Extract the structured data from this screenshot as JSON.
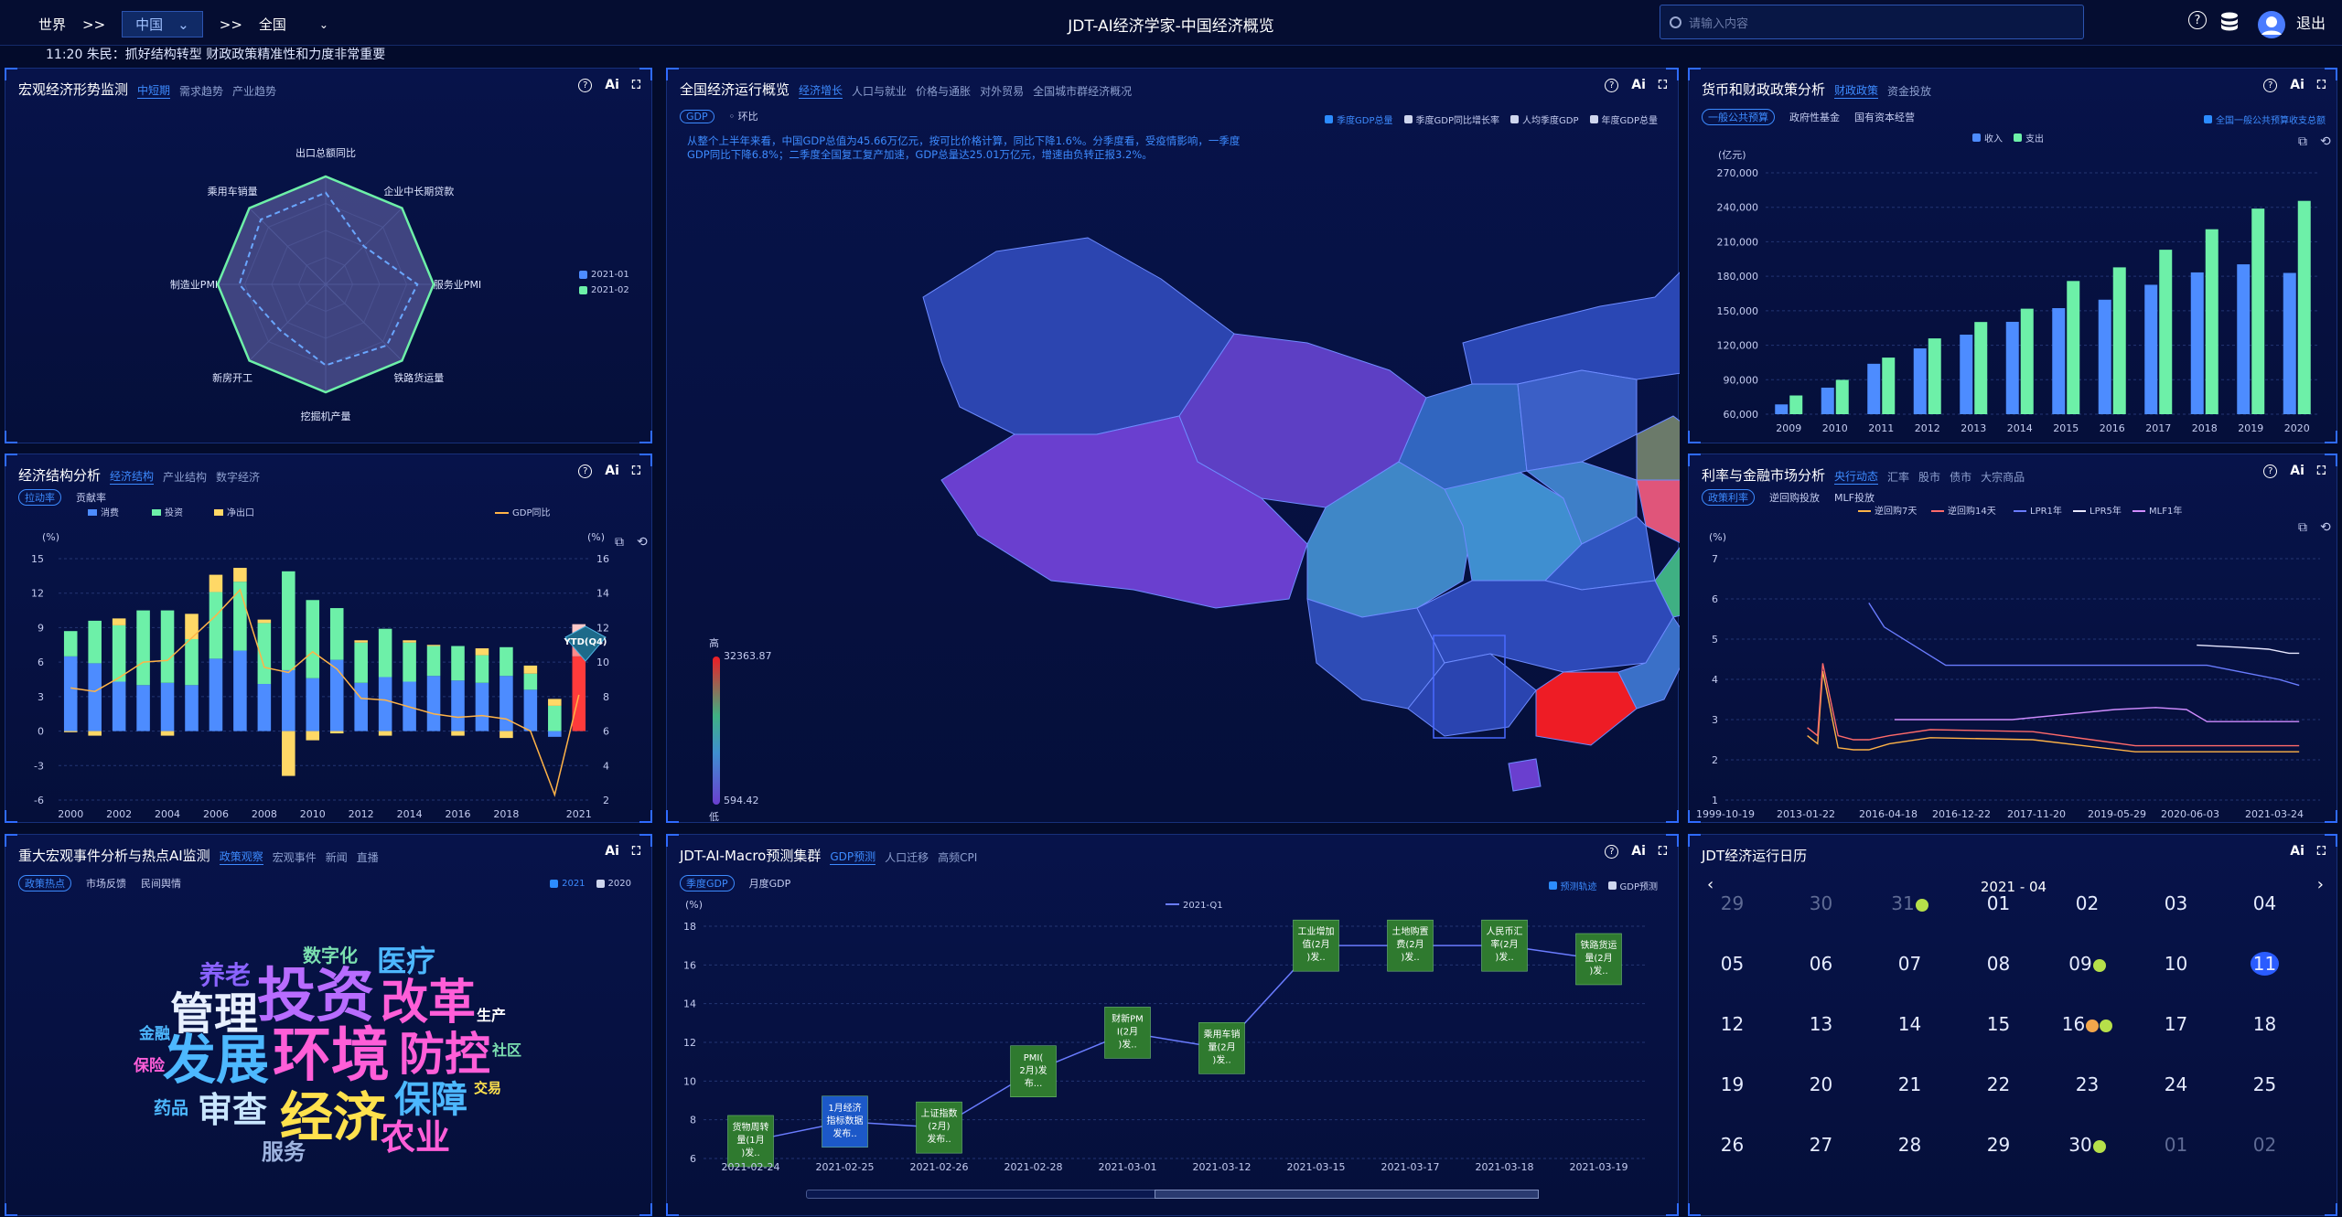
{
  "topbar": {
    "crumb_world": "世界",
    "sep1": ">>",
    "selected_region": "中国",
    "sep2": ">>",
    "crumb_all": "全国",
    "title": "JDT-AI经济学家-中国经济概览",
    "search_placeholder": "请输入内容",
    "logout": "退出"
  },
  "ticker": "11:20  朱民：抓好结构转型 财政政策精准性和力度非常重要",
  "macro": {
    "title": "宏观经济形势监测",
    "tabs": [
      "中短期",
      "需求趋势",
      "产业趋势"
    ],
    "axes": [
      "出口总额同比",
      "企业中长期贷款",
      "服务业PMI",
      "铁路货运量",
      "挖掘机产量",
      "新房开工",
      "制造业PMI",
      "乘用车销量"
    ],
    "legend": [
      "2021-01",
      "2021-02"
    ]
  },
  "structure": {
    "title": "经济结构分析",
    "tabs": [
      "经济结构",
      "产业结构",
      "数字经济"
    ],
    "subtabs": [
      "拉动率",
      "贡献率"
    ],
    "legend": [
      "消费",
      "投资",
      "净出口"
    ],
    "legend_line": "GDP同比",
    "unit_left": "(%)",
    "unit_right": "(%)",
    "yticks_left": [
      "15",
      "12",
      "9",
      "6",
      "3",
      "0",
      "-3",
      "-6"
    ],
    "yticks_right": [
      "16",
      "14",
      "12",
      "10",
      "8",
      "6",
      "4",
      "2"
    ],
    "xticks": [
      "2000",
      "2002",
      "2004",
      "2006",
      "2008",
      "2010",
      "2012",
      "2014",
      "2016",
      "2018",
      "2021"
    ],
    "badge": "YTD(Q4)"
  },
  "overview": {
    "title": "全国经济运行概览",
    "tabs": [
      "经济增长",
      "人口与就业",
      "价格与通胀",
      "对外贸易",
      "全国城市群经济概况"
    ],
    "subtabs": [
      "GDP",
      "环比"
    ],
    "legend": [
      "季度GDP总量",
      "季度GDP同比增长率",
      "人均季度GDP",
      "年度GDP总量"
    ],
    "text": "从整个上半年来看，中国GDP总值为45.66万亿元，按可比价格计算，同比下降1.6%。分季度看，受疫情影响，一季度GDP同比下降6.8%；二季度全国复工复产加速，GDP总量达25.01万亿元，增速由负转正报3.2%。",
    "scale_high": "高",
    "scale_low": "低",
    "scale_max": "32363.87",
    "scale_min": "594.42"
  },
  "fiscal": {
    "title": "货币和财政政策分析",
    "tabs": [
      "财政政策",
      "资金投放"
    ],
    "subtabs": [
      "一般公共预算",
      "政府性基金",
      "国有资本经营"
    ],
    "legend_right": "全国一般公共预算收支总额",
    "legend": [
      "收入",
      "支出"
    ],
    "unit": "(亿元)",
    "yticks": [
      "270,000",
      "240,000",
      "210,000",
      "180,000",
      "150,000",
      "120,000",
      "90,000",
      "60,000"
    ],
    "years": [
      "2009",
      "2010",
      "2011",
      "2012",
      "2013",
      "2014",
      "2015",
      "2016",
      "2017",
      "2018",
      "2019",
      "2020"
    ]
  },
  "rates": {
    "title": "利率与金融市场分析",
    "tabs": [
      "央行动态",
      "汇率",
      "股市",
      "债市",
      "大宗商品"
    ],
    "subtabs": [
      "政策利率",
      "逆回购投放",
      "MLF投放"
    ],
    "legend": [
      "逆回购7天",
      "逆回购14天",
      "LPR1年",
      "LPR5年",
      "MLF1年"
    ],
    "unit": "(%)",
    "yticks": [
      "7",
      "6",
      "5",
      "4",
      "3",
      "2",
      "1"
    ],
    "xticks": [
      "1999-10-19",
      "2013-01-22",
      "2016-04-18",
      "2016-12-22",
      "2017-11-20",
      "2019-05-29",
      "2020-06-03",
      "2021-03-24"
    ]
  },
  "events": {
    "title": "重大宏观事件分析与热点AI监测",
    "tabs": [
      "政策观察",
      "宏观事件",
      "新闻",
      "直播"
    ],
    "subtabs": [
      "政策热点",
      "市场反馈",
      "民间舆情"
    ],
    "legend": [
      "2021",
      "2020"
    ],
    "words": [
      "投资",
      "发展",
      "环境",
      "经济",
      "管理",
      "改革",
      "防控",
      "审查",
      "保障",
      "农业",
      "养老",
      "医疗",
      "数字化",
      "服务",
      "金融",
      "保险",
      "药品",
      "生产",
      "社区",
      "交易"
    ]
  },
  "forecast": {
    "title": "JDT-AI-Macro预测集群",
    "tabs": [
      "GDP预测",
      "人口迁移",
      "高频CPI"
    ],
    "subtabs": [
      "季度GDP",
      "月度GDP"
    ],
    "legend_right": [
      "预测轨迹",
      "GDP预测"
    ],
    "series_label": "2021-Q1",
    "unit": "(%)",
    "yticks": [
      "18",
      "16",
      "14",
      "12",
      "10",
      "8",
      "6"
    ],
    "xticks": [
      "2021-02-24",
      "2021-02-25",
      "2021-02-26",
      "2021-02-28",
      "2021-03-01",
      "2021-03-12",
      "2021-03-15",
      "2021-03-17",
      "2021-03-18",
      "2021-03-19"
    ],
    "boxes": [
      "货物周转量(1月)发...",
      "1月经济指标数据发布...",
      "上证指数(2月)发布...",
      "PMI(2月)发布...",
      "财新PMI(2月)发...",
      "乘用车销量(2月)发...",
      "工业增加值(2月)发...",
      "土地购置费(2月)发...",
      "人民币汇率(2月)发...",
      "铁路货运量(2月)发..."
    ]
  },
  "calendar": {
    "title": "JDT经济运行日历",
    "month": "2021 - 04",
    "weeks": [
      [
        "29",
        "30",
        "31",
        "01",
        "02",
        "03",
        "04"
      ],
      [
        "05",
        "06",
        "07",
        "08",
        "09",
        "10",
        "11"
      ],
      [
        "12",
        "13",
        "14",
        "15",
        "16",
        "17",
        "18"
      ],
      [
        "19",
        "20",
        "21",
        "22",
        "23",
        "24",
        "25"
      ],
      [
        "26",
        "27",
        "28",
        "29",
        "30",
        "01",
        "02"
      ]
    ]
  },
  "tools": {
    "ai": "Ai"
  },
  "chart_data": [
    {
      "type": "radar",
      "title": "宏观经济形势监测",
      "axes": [
        "出口总额同比",
        "企业中长期贷款",
        "服务业PMI",
        "铁路货运量",
        "挖掘机产量",
        "新房开工",
        "制造业PMI",
        "乘用车销量"
      ],
      "series": [
        {
          "name": "2021-01",
          "values": [
            0.85,
            0.5,
            0.85,
            0.8,
            0.75,
            0.6,
            0.8,
            0.85
          ]
        },
        {
          "name": "2021-02",
          "values": [
            1,
            1,
            1,
            1,
            1,
            1,
            1,
            1
          ]
        }
      ]
    },
    {
      "type": "bar",
      "title": "经济结构分析",
      "categories": [
        "2000",
        "2001",
        "2002",
        "2003",
        "2004",
        "2005",
        "2006",
        "2007",
        "2008",
        "2009",
        "2010",
        "2011",
        "2012",
        "2013",
        "2014",
        "2015",
        "2016",
        "2017",
        "2018",
        "2019",
        "2020",
        "2021"
      ],
      "series": [
        {
          "name": "消费",
          "values": [
            6.5,
            5.9,
            4.3,
            4.0,
            4.2,
            4.0,
            6.3,
            7.0,
            4.1,
            5.3,
            4.6,
            6.2,
            4.2,
            4.7,
            4.3,
            4.8,
            4.4,
            4.2,
            4.8,
            3.6,
            -0.5,
            6.5
          ]
        },
        {
          "name": "投资",
          "values": [
            2.2,
            3.7,
            4.9,
            6.5,
            6.3,
            4.0,
            5.8,
            6.0,
            5.3,
            8.6,
            6.8,
            4.5,
            3.5,
            4.2,
            3.4,
            2.6,
            3.0,
            2.4,
            2.5,
            1.4,
            2.2,
            1.1
          ]
        },
        {
          "name": "净出口",
          "values": [
            -0.1,
            -0.4,
            0.6,
            0,
            -0.4,
            2.2,
            1.5,
            1.2,
            0.3,
            -3.9,
            -0.8,
            -0.2,
            0.2,
            -0.4,
            0.2,
            0.1,
            -0.4,
            0.6,
            -0.6,
            0.7,
            0.6,
            1.7
          ]
        },
        {
          "name": "GDP同比",
          "values": [
            8.5,
            8.3,
            9.1,
            10.0,
            10.1,
            11.4,
            12.7,
            14.2,
            9.7,
            9.4,
            10.6,
            9.6,
            7.9,
            7.8,
            7.4,
            7.0,
            6.8,
            6.9,
            6.7,
            6.0,
            2.3,
            8.1
          ]
        }
      ],
      "ylim": [
        -6,
        15
      ]
    },
    {
      "type": "bar",
      "title": "货币和财政政策分析",
      "categories": [
        "2009",
        "2010",
        "2011",
        "2012",
        "2013",
        "2014",
        "2015",
        "2016",
        "2017",
        "2018",
        "2019",
        "2020"
      ],
      "series": [
        {
          "name": "收入",
          "values": [
            68518,
            83101,
            103874,
            117253,
            129209,
            140370,
            152269,
            159604,
            172592,
            183359,
            190390,
            182895
          ]
        },
        {
          "name": "支出",
          "values": [
            76299,
            89874,
            109247,
            125952,
            140212,
            151785,
            175877,
            187755,
            203085,
            220904,
            238858,
            245588
          ]
        }
      ],
      "ylim": [
        60000,
        270000
      ]
    },
    {
      "type": "line",
      "title": "利率与金融市场分析",
      "series": [
        {
          "name": "逆回购7天",
          "values": [
            2.6,
            2.4,
            4.2,
            2.3,
            2.25,
            2.25,
            2.4,
            2.55,
            2.5,
            2.2,
            2.2
          ]
        },
        {
          "name": "逆回购14天",
          "values": [
            2.8,
            2.6,
            4.4,
            2.6,
            2.5,
            2.5,
            2.6,
            2.75,
            2.7,
            2.35,
            2.35
          ]
        },
        {
          "name": "LPR1年",
          "values": [
            5.9,
            5.3,
            4.35,
            4.35,
            4.35,
            4.35,
            4.35,
            4.35,
            4.2,
            4.0,
            3.85
          ]
        },
        {
          "name": "LPR5年",
          "values": [
            4.85,
            4.8,
            4.75,
            4.65,
            4.65
          ]
        },
        {
          "name": "MLF1年",
          "values": [
            3.0,
            3.0,
            3.0,
            3.25,
            3.3,
            3.25,
            2.95,
            2.95
          ]
        }
      ],
      "ylim": [
        1,
        7
      ]
    },
    {
      "type": "line",
      "title": "JDT-AI-Macro预测集群",
      "categories": [
        "2021-02-24",
        "2021-02-25",
        "2021-02-26",
        "2021-02-28",
        "2021-03-01",
        "2021-03-12",
        "2021-03-15",
        "2021-03-17",
        "2021-03-18",
        "2021-03-19"
      ],
      "series": [
        {
          "name": "2021-Q1",
          "values": [
            6.9,
            7.9,
            7.6,
            10.5,
            12.5,
            11.7,
            17,
            17,
            17,
            16.3
          ]
        }
      ],
      "ylim": [
        6,
        18
      ]
    }
  ]
}
